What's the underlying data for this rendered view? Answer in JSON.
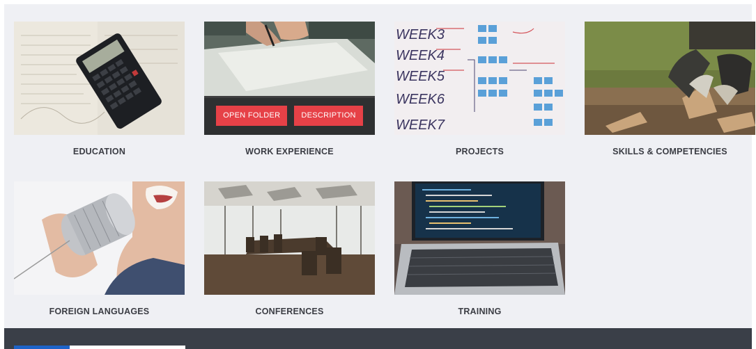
{
  "cards": [
    {
      "caption": "EDUCATION",
      "image_icon": "calculator-image"
    },
    {
      "caption": "WORK EXPERIENCE",
      "image_icon": "writing-hands-image",
      "open_label": "OPEN FOLDER",
      "description_label": "DESCRIPTION"
    },
    {
      "caption": "PROJECTS",
      "image_icon": "whiteboard-image",
      "whiteboard_lines": [
        "WEEK3",
        "WEEK4",
        "WEEK5",
        "WEEK6",
        "WEEK7"
      ]
    },
    {
      "caption": "SKILLS & COMPETENCIES",
      "image_icon": "gloved-hands-image"
    },
    {
      "caption": "FOREIGN LANGUAGES",
      "image_icon": "tin-can-phone-image"
    },
    {
      "caption": "CONFERENCES",
      "image_icon": "conference-room-image"
    },
    {
      "caption": "TRAINING",
      "image_icon": "laptop-code-image"
    }
  ],
  "colors": {
    "panel_bg": "#eff0f4",
    "button_red": "#e64147",
    "footer_bg": "#3a3f48",
    "accent_blue": "#1d63c8"
  }
}
